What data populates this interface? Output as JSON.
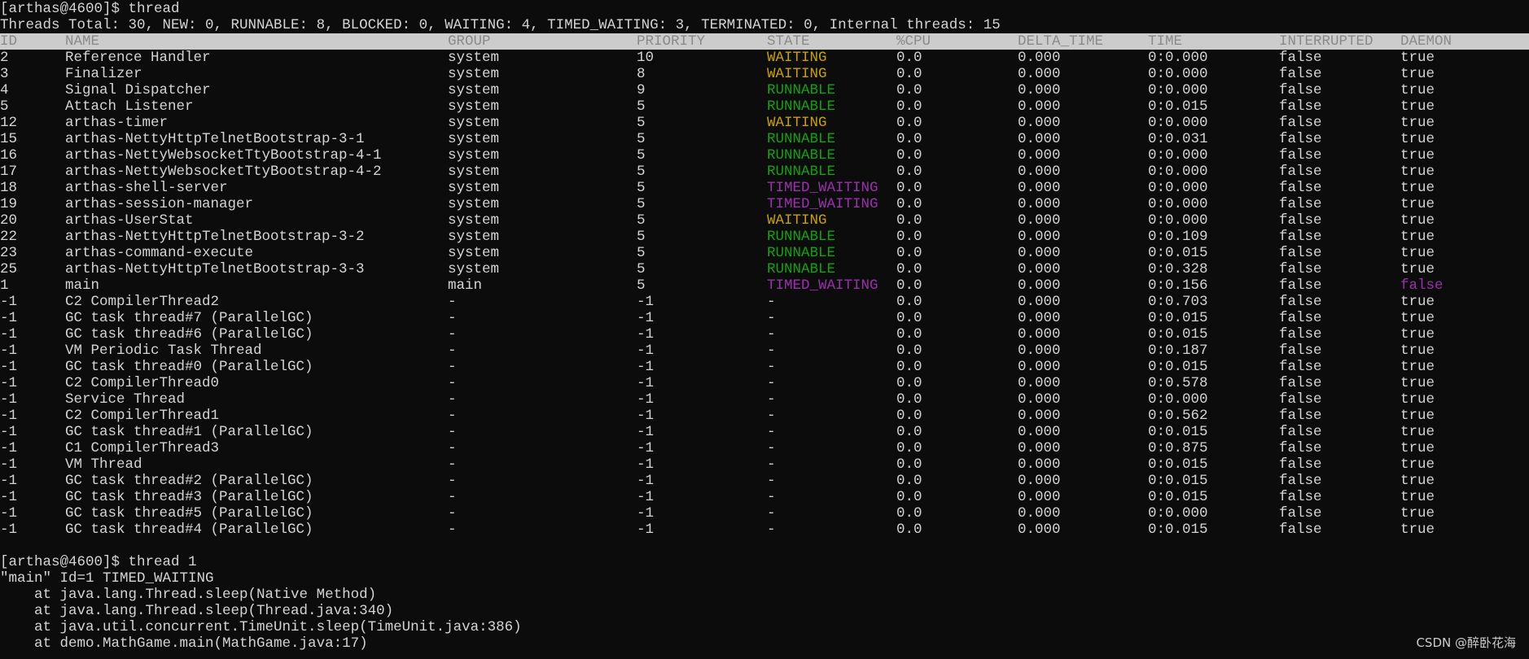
{
  "terminal": {
    "prompt1": "[arthas@4600]$ thread",
    "summary": "Threads Total: 30, NEW: 0, RUNNABLE: 8, BLOCKED: 0, WAITING: 4, TIMED_WAITING: 3, TERMINATED: 0, Internal threads: 15",
    "prompt2": "[arthas@4600]$ thread 1",
    "stack": [
      "\"main\" Id=1 TIMED_WAITING",
      "    at java.lang.Thread.sleep(Native Method)",
      "    at java.lang.Thread.sleep(Thread.java:340)",
      "    at java.util.concurrent.TimeUnit.sleep(TimeUnit.java:386)",
      "    at demo.MathGame.main(MathGame.java:17)"
    ]
  },
  "table": {
    "headers": [
      "ID",
      "NAME",
      "GROUP",
      "PRIORITY",
      "STATE",
      "%CPU",
      "DELTA_TIME",
      "TIME",
      "INTERRUPTED",
      "DAEMON"
    ],
    "rows": [
      [
        "2",
        "Reference Handler",
        "system",
        "10",
        "WAITING",
        "0.0",
        "0.000",
        "0:0.000",
        "false",
        "true"
      ],
      [
        "3",
        "Finalizer",
        "system",
        "8",
        "WAITING",
        "0.0",
        "0.000",
        "0:0.000",
        "false",
        "true"
      ],
      [
        "4",
        "Signal Dispatcher",
        "system",
        "9",
        "RUNNABLE",
        "0.0",
        "0.000",
        "0:0.000",
        "false",
        "true"
      ],
      [
        "5",
        "Attach Listener",
        "system",
        "5",
        "RUNNABLE",
        "0.0",
        "0.000",
        "0:0.015",
        "false",
        "true"
      ],
      [
        "12",
        "arthas-timer",
        "system",
        "5",
        "WAITING",
        "0.0",
        "0.000",
        "0:0.000",
        "false",
        "true"
      ],
      [
        "15",
        "arthas-NettyHttpTelnetBootstrap-3-1",
        "system",
        "5",
        "RUNNABLE",
        "0.0",
        "0.000",
        "0:0.031",
        "false",
        "true"
      ],
      [
        "16",
        "arthas-NettyWebsocketTtyBootstrap-4-1",
        "system",
        "5",
        "RUNNABLE",
        "0.0",
        "0.000",
        "0:0.000",
        "false",
        "true"
      ],
      [
        "17",
        "arthas-NettyWebsocketTtyBootstrap-4-2",
        "system",
        "5",
        "RUNNABLE",
        "0.0",
        "0.000",
        "0:0.000",
        "false",
        "true"
      ],
      [
        "18",
        "arthas-shell-server",
        "system",
        "5",
        "TIMED_WAITING",
        "0.0",
        "0.000",
        "0:0.000",
        "false",
        "true"
      ],
      [
        "19",
        "arthas-session-manager",
        "system",
        "5",
        "TIMED_WAITING",
        "0.0",
        "0.000",
        "0:0.000",
        "false",
        "true"
      ],
      [
        "20",
        "arthas-UserStat",
        "system",
        "5",
        "WAITING",
        "0.0",
        "0.000",
        "0:0.000",
        "false",
        "true"
      ],
      [
        "22",
        "arthas-NettyHttpTelnetBootstrap-3-2",
        "system",
        "5",
        "RUNNABLE",
        "0.0",
        "0.000",
        "0:0.109",
        "false",
        "true"
      ],
      [
        "23",
        "arthas-command-execute",
        "system",
        "5",
        "RUNNABLE",
        "0.0",
        "0.000",
        "0:0.015",
        "false",
        "true"
      ],
      [
        "25",
        "arthas-NettyHttpTelnetBootstrap-3-3",
        "system",
        "5",
        "RUNNABLE",
        "0.0",
        "0.000",
        "0:0.328",
        "false",
        "true"
      ],
      [
        "1",
        "main",
        "main",
        "5",
        "TIMED_WAITING",
        "0.0",
        "0.000",
        "0:0.156",
        "false",
        "false"
      ],
      [
        "-1",
        "C2 CompilerThread2",
        "-",
        "-1",
        "-",
        "0.0",
        "0.000",
        "0:0.703",
        "false",
        "true"
      ],
      [
        "-1",
        "GC task thread#7 (ParallelGC)",
        "-",
        "-1",
        "-",
        "0.0",
        "0.000",
        "0:0.015",
        "false",
        "true"
      ],
      [
        "-1",
        "GC task thread#6 (ParallelGC)",
        "-",
        "-1",
        "-",
        "0.0",
        "0.000",
        "0:0.015",
        "false",
        "true"
      ],
      [
        "-1",
        "VM Periodic Task Thread",
        "-",
        "-1",
        "-",
        "0.0",
        "0.000",
        "0:0.187",
        "false",
        "true"
      ],
      [
        "-1",
        "GC task thread#0 (ParallelGC)",
        "-",
        "-1",
        "-",
        "0.0",
        "0.000",
        "0:0.015",
        "false",
        "true"
      ],
      [
        "-1",
        "C2 CompilerThread0",
        "-",
        "-1",
        "-",
        "0.0",
        "0.000",
        "0:0.578",
        "false",
        "true"
      ],
      [
        "-1",
        "Service Thread",
        "-",
        "-1",
        "-",
        "0.0",
        "0.000",
        "0:0.000",
        "false",
        "true"
      ],
      [
        "-1",
        "C2 CompilerThread1",
        "-",
        "-1",
        "-",
        "0.0",
        "0.000",
        "0:0.562",
        "false",
        "true"
      ],
      [
        "-1",
        "GC task thread#1 (ParallelGC)",
        "-",
        "-1",
        "-",
        "0.0",
        "0.000",
        "0:0.015",
        "false",
        "true"
      ],
      [
        "-1",
        "C1 CompilerThread3",
        "-",
        "-1",
        "-",
        "0.0",
        "0.000",
        "0:0.875",
        "false",
        "true"
      ],
      [
        "-1",
        "VM Thread",
        "-",
        "-1",
        "-",
        "0.0",
        "0.000",
        "0:0.015",
        "false",
        "true"
      ],
      [
        "-1",
        "GC task thread#2 (ParallelGC)",
        "-",
        "-1",
        "-",
        "0.0",
        "0.000",
        "0:0.015",
        "false",
        "true"
      ],
      [
        "-1",
        "GC task thread#3 (ParallelGC)",
        "-",
        "-1",
        "-",
        "0.0",
        "0.000",
        "0:0.015",
        "false",
        "true"
      ],
      [
        "-1",
        "GC task thread#5 (ParallelGC)",
        "-",
        "-1",
        "-",
        "0.0",
        "0.000",
        "0:0.000",
        "false",
        "true"
      ],
      [
        "-1",
        "GC task thread#4 (ParallelGC)",
        "-",
        "-1",
        "-",
        "0.0",
        "0.000",
        "0:0.015",
        "false",
        "true"
      ]
    ]
  },
  "colors": {
    "background": "#0c0c0c",
    "text": "#d4d4d4",
    "header_bar": "#cccccc",
    "waiting": "#c8a000",
    "runnable": "#13a10e",
    "timed_waiting": "#9b2fae"
  },
  "watermark": "CSDN @醉卧花海"
}
